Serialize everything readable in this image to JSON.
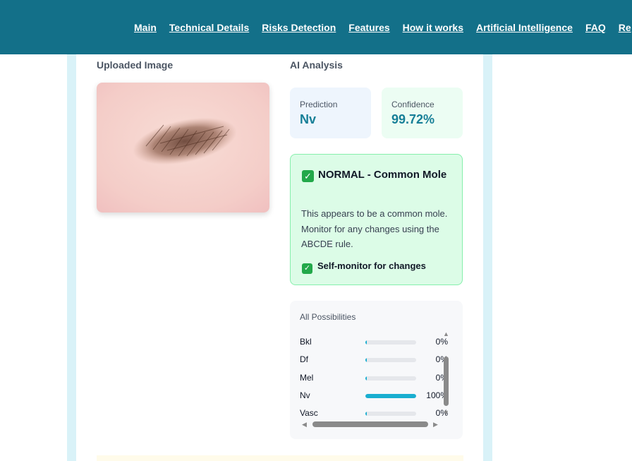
{
  "nav": [
    "Main",
    "Technical Details",
    "Risks Detection",
    "Features",
    "How it works",
    "Artificial Intelligence",
    "FAQ",
    "Re"
  ],
  "upload": {
    "heading": "Uploaded Image"
  },
  "analysis": {
    "heading": "AI Analysis",
    "prediction_label": "Prediction",
    "prediction_value": "Nv",
    "confidence_label": "Confidence",
    "confidence_value": "99.72%"
  },
  "result": {
    "title": "NORMAL - Common Mole",
    "description": "This appears to be a common mole. Monitor for any changes using the ABCDE rule.",
    "tip": "Self-monitor for changes"
  },
  "possibilities": {
    "title": "All Possibilities",
    "rows": [
      {
        "name": "Bkl",
        "pct": "0%",
        "level": 0
      },
      {
        "name": "Df",
        "pct": "0%",
        "level": 0
      },
      {
        "name": "Mel",
        "pct": "0%",
        "level": 0
      },
      {
        "name": "Nv",
        "pct": "100%",
        "level": 100
      },
      {
        "name": "Vasc",
        "pct": "0%",
        "level": 0
      }
    ]
  },
  "colors": {
    "header": "#137089",
    "accent": "#167f97",
    "success": "#22a84a",
    "bar": "#19aed0"
  }
}
